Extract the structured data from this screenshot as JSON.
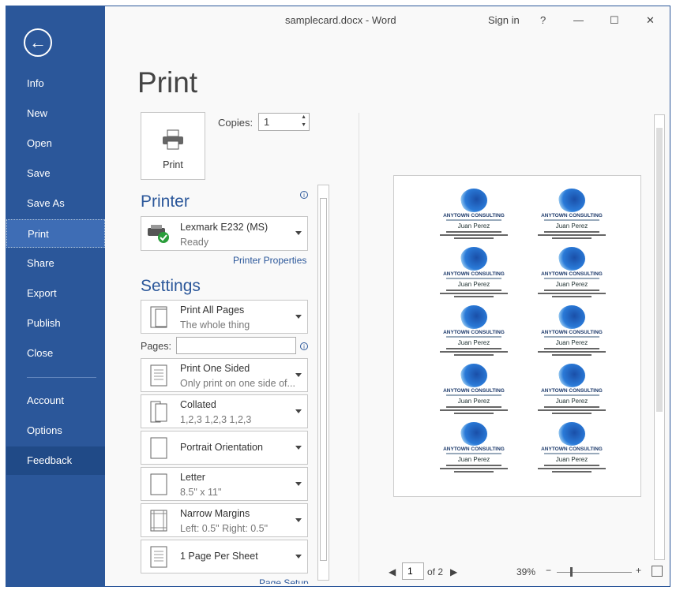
{
  "titlebar": {
    "title": "samplecard.docx - Word",
    "sign_in": "Sign in",
    "help": "?",
    "minimize": "—",
    "maximize": "☐",
    "close": "✕"
  },
  "sidebar": {
    "back_icon": "arrow-left-circle",
    "items": [
      {
        "label": "Info"
      },
      {
        "label": "New"
      },
      {
        "label": "Open"
      },
      {
        "label": "Save"
      },
      {
        "label": "Save As"
      },
      {
        "label": "Print",
        "selected": true
      },
      {
        "label": "Share"
      },
      {
        "label": "Export"
      },
      {
        "label": "Publish"
      },
      {
        "label": "Close"
      },
      {
        "label": "Account"
      },
      {
        "label": "Options"
      },
      {
        "label": "Feedback"
      }
    ],
    "color": "#2b579a"
  },
  "print": {
    "title": "Print",
    "button_label": "Print",
    "copies_label": "Copies:",
    "copies_value": "1"
  },
  "printer": {
    "heading": "Printer",
    "name": "Lexmark E232 (MS)",
    "status": "Ready",
    "properties_link": "Printer Properties"
  },
  "settings": {
    "heading": "Settings",
    "pages_label": "Pages:",
    "pages_value": "",
    "options": [
      {
        "main": "Print All Pages",
        "sub": "The whole thing"
      },
      {
        "main": "Print One Sided",
        "sub": "Only print on one side of..."
      },
      {
        "main": "Collated",
        "sub": "1,2,3    1,2,3    1,2,3"
      },
      {
        "main": "Portrait Orientation",
        "sub": ""
      },
      {
        "main": "Letter",
        "sub": "8.5\" x 11\""
      },
      {
        "main": "Narrow Margins",
        "sub": "Left:  0.5\"    Right:  0.5\""
      },
      {
        "main": "1 Page Per Sheet",
        "sub": ""
      }
    ],
    "page_setup_link": "Page Setup"
  },
  "preview": {
    "card": {
      "company": "ANYTOWN CONSULTING",
      "name": "Juan Perez"
    },
    "card_count": 10,
    "current_page": "1",
    "of_pages": "of 2",
    "zoom": "39%",
    "zoom_minus": "−",
    "zoom_plus": "+"
  }
}
